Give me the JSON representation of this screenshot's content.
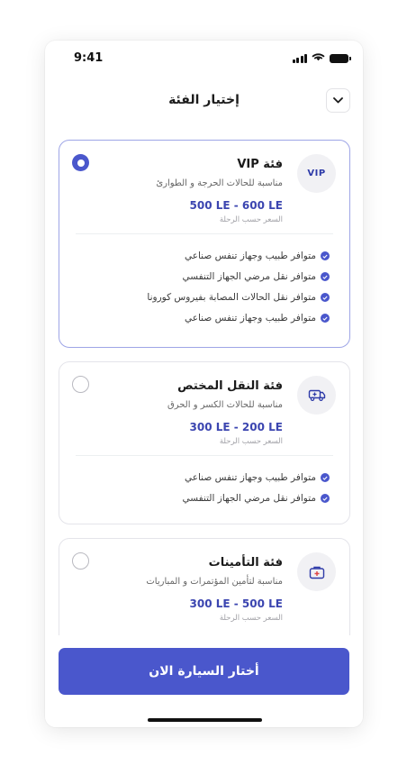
{
  "status_bar": {
    "time": "9:41"
  },
  "header": {
    "title": "إختيار الفئة"
  },
  "categories": [
    {
      "name": "فئة VIP",
      "badge": "VIP",
      "description": "مناسبة للحالات الحرجة و الطوارئ",
      "price": "500 LE - 600 LE",
      "price_note": "السعر حسب الرحلة",
      "selected": true,
      "features": [
        "متوافر طبيب وجهاز تنفس صناعي",
        "متوافر نقل مرضي الجهاز التنفسي",
        "متوافر نقل الحالات المصابة بفيروس كورونا",
        "متوافر طبيب وجهاز تنفس صناعي"
      ]
    },
    {
      "name": "فئة النقل المختص",
      "description": "مناسبة للحالات الكسر و الحرق",
      "price": "300 LE - 200 LE",
      "price_note": "السعر حسب الرحلة",
      "selected": false,
      "features": [
        "متوافر طبيب وجهاز تنفس صناعي",
        "متوافر نقل مرضي الجهاز التنفسي"
      ]
    },
    {
      "name": "فئة التأمينات",
      "description": "مناسبة لتأمين المؤتمرات و المباريات",
      "price": "300 LE - 500 LE",
      "price_note": "السعر حسب الرحلة",
      "selected": false,
      "features": []
    }
  ],
  "cta": {
    "label": "أختار السيارة الان"
  },
  "colors": {
    "accent": "#4A57CC",
    "selected_border": "#9EA5E6",
    "price": "#3B45B0"
  }
}
